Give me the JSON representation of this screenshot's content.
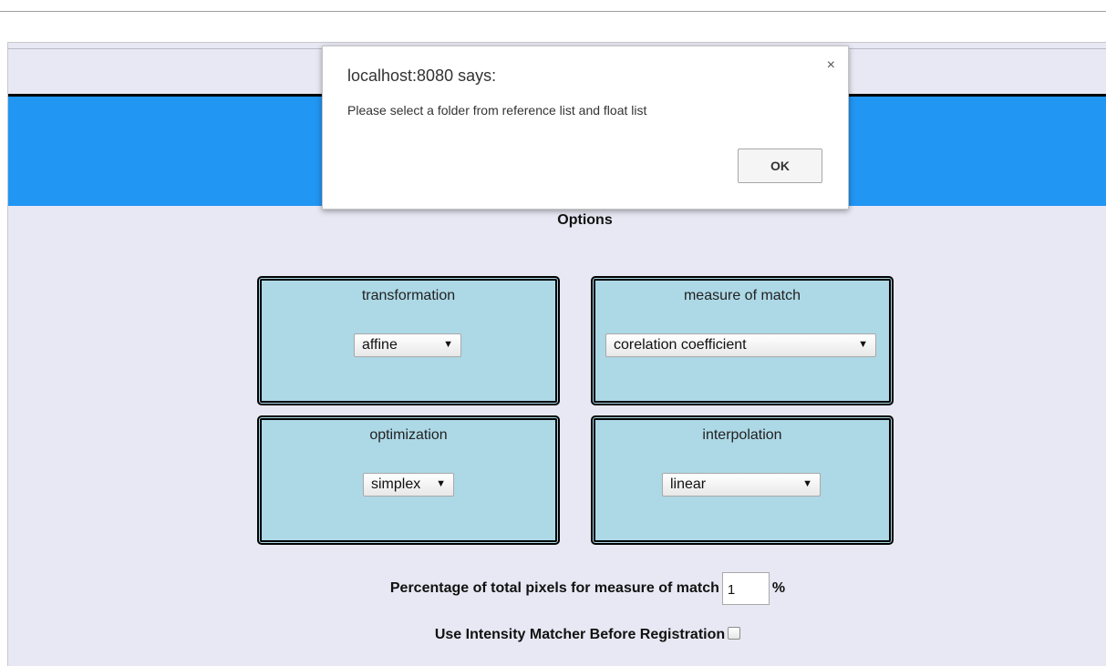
{
  "dialog": {
    "title": "localhost:8080 says:",
    "message": "Please select a folder from reference list and float list",
    "ok_label": "OK",
    "close_glyph": "×"
  },
  "options": {
    "title": "Options",
    "cards": {
      "transformation": {
        "label": "transformation",
        "selected": "affine"
      },
      "measure_of_match": {
        "label": "measure of match",
        "selected": "corelation coefficient"
      },
      "optimization": {
        "label": "optimization",
        "selected": "simplex"
      },
      "interpolation": {
        "label": "interpolation",
        "selected": "linear"
      }
    },
    "dropdown_arrow": "▼"
  },
  "pixels": {
    "label": "Percentage of total pixels for measure of match",
    "value": "1",
    "unit": "%"
  },
  "intensity": {
    "label": "Use Intensity Matcher Before Registration",
    "checked": false
  },
  "colors": {
    "header": "#2196f3",
    "page_bg": "#e8e8f4",
    "card_bg": "#add8e6"
  }
}
